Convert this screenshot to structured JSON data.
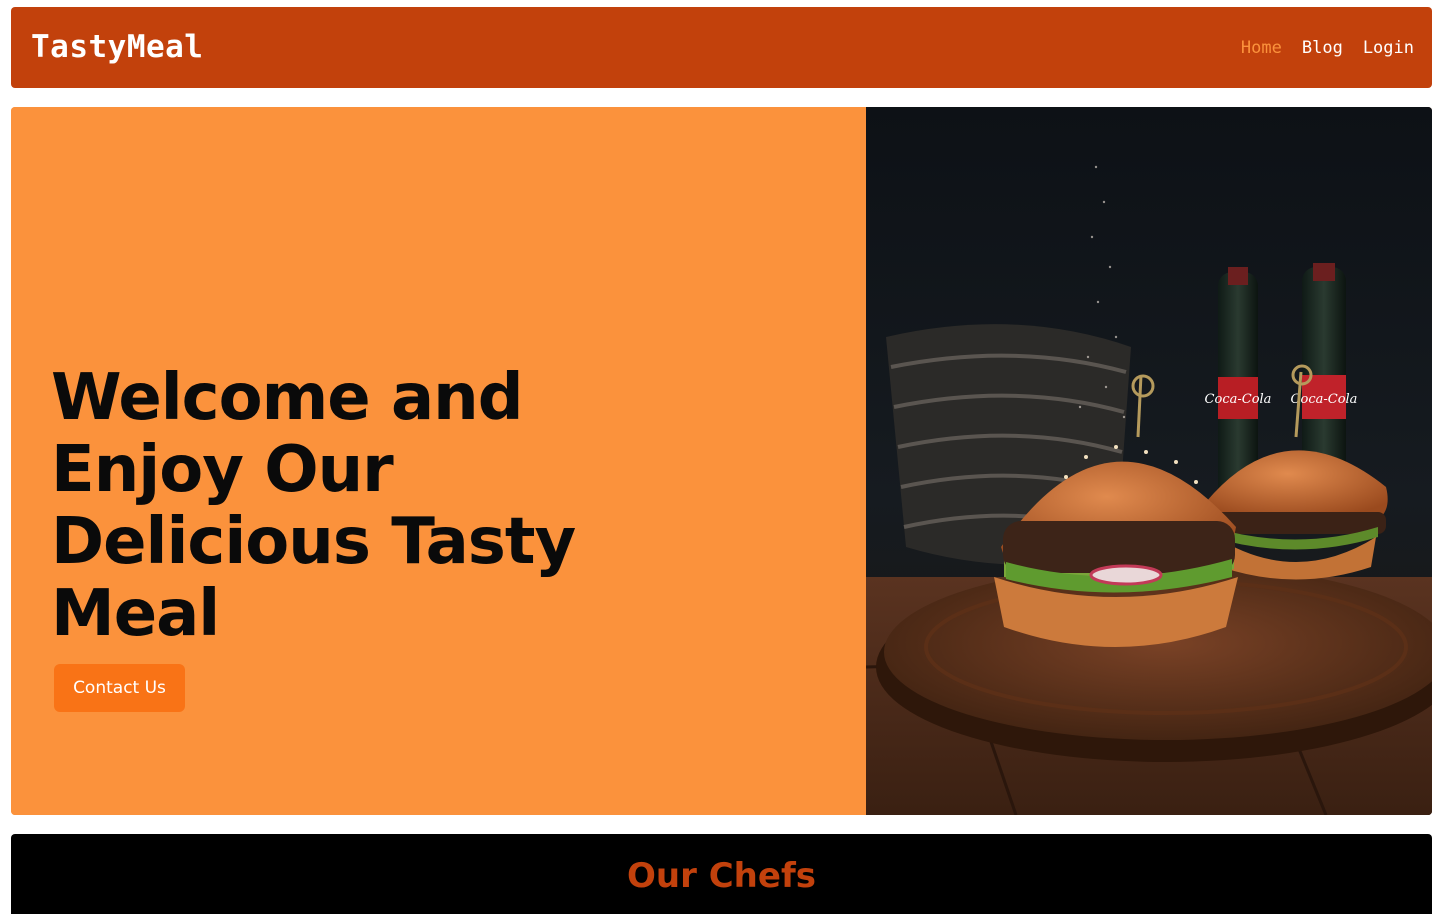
{
  "navbar": {
    "brand": "TastyMeal",
    "links": [
      {
        "label": "Home",
        "active": true
      },
      {
        "label": "Blog",
        "active": false
      },
      {
        "label": "Login",
        "active": false
      }
    ]
  },
  "hero": {
    "title": "Welcome and Enjoy Our Delicious Tasty Meal",
    "button_label": "Contact Us",
    "image_alt": "two burgers on a wooden board with cola bottles",
    "bottle_label_text": "Coca-Cola"
  },
  "chefs": {
    "title": "Our Chefs"
  },
  "colors": {
    "navbar_bg": "#c2410c",
    "hero_bg": "#fb923c",
    "button_bg": "#f97316",
    "active_link": "#fb923c",
    "chefs_title": "#c2410c"
  }
}
